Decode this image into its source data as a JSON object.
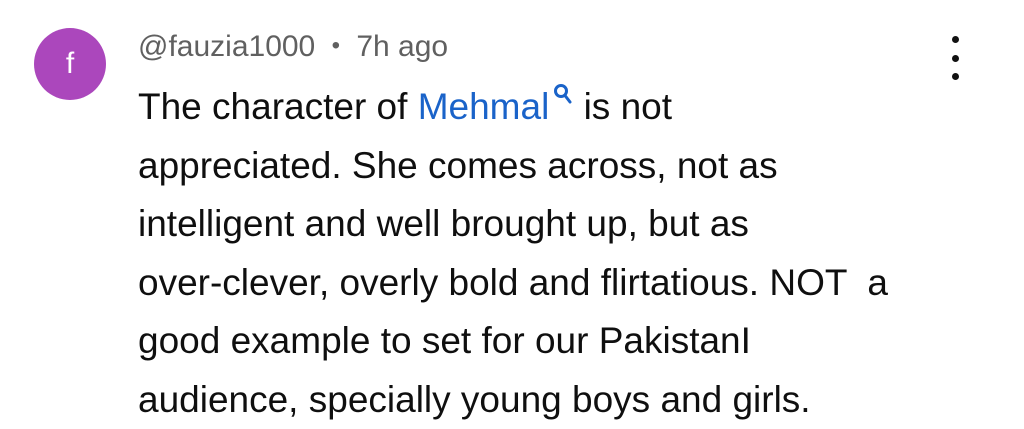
{
  "comment": {
    "avatar": {
      "letter": "f",
      "color": "#ab47bc"
    },
    "author": "@fauzia1000",
    "separator": "•",
    "time": "7h ago",
    "menu_icon": "more-vert-icon",
    "mention_color": "#1a63c9",
    "lines": {
      "l1_before": "The character of ",
      "l1_mention": "Mehmal",
      "l1_after": " is not",
      "l2": "appreciated. She comes across, not as",
      "l3": "intelligent and well brought up, but as",
      "l4": "over-clever, overly bold and flirtatious. NOT  a",
      "l5": "good example to set for our PakistanI",
      "l6": "audience, specially young boys and girls."
    }
  }
}
